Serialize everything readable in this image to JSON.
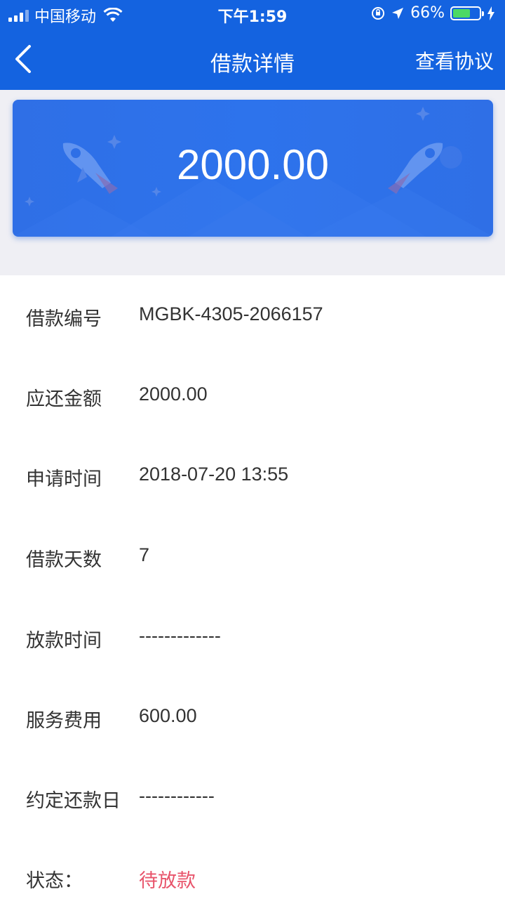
{
  "status_bar": {
    "carrier": "中国移动",
    "time": "下午1:59",
    "battery_percent": "66%",
    "battery_level": 0.66
  },
  "nav": {
    "title": "借款详情",
    "right_label": "查看协议"
  },
  "banner": {
    "amount": "2000.00"
  },
  "details": {
    "rows": [
      {
        "label": "借款编号",
        "value": "MGBK-4305-2066157"
      },
      {
        "label": "应还金额",
        "value": "2000.00"
      },
      {
        "label": "申请时间",
        "value": "2018-07-20 13:55"
      },
      {
        "label": "借款天数",
        "value": "7"
      },
      {
        "label": "放款时间",
        "value": "-------------"
      },
      {
        "label": "服务费用",
        "value": "600.00"
      },
      {
        "label": "约定还款日",
        "value": "------------"
      },
      {
        "label": "状态：",
        "value": "待放款"
      }
    ]
  },
  "colors": {
    "header_bg": "#1463e0",
    "status_red": "#e8546b",
    "battery_green": "#4cd964"
  }
}
